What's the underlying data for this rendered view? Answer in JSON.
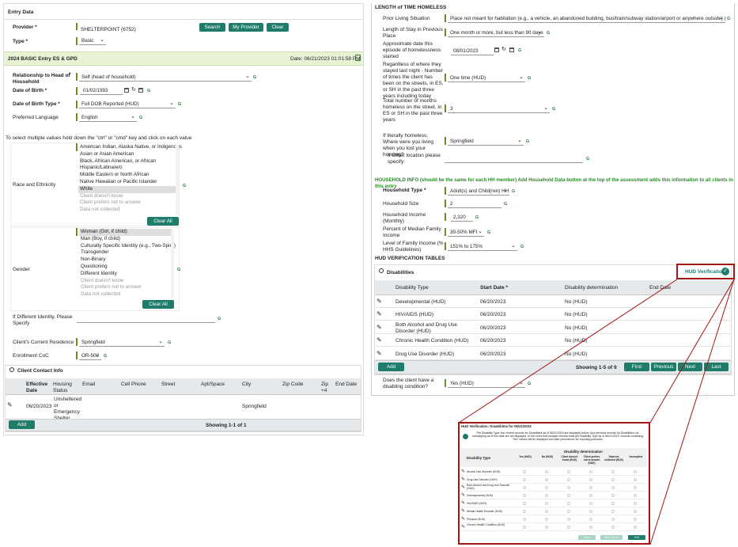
{
  "left": {
    "section_title": "Entry Data",
    "provider_label": "Provider *",
    "provider_value": "SHELTERPOINT (6752)",
    "search_btn": "Search",
    "my_provider_btn": "My Provider",
    "clear_btn": "Clear",
    "type_label": "Type *",
    "type_value": "Basic",
    "entry_header": "2024 BASIC Entry ES & GPD",
    "entry_date": "Date: 06/21/2023 01:01:58 PM",
    "rel_label": "Relationship to Head of Household",
    "rel_value": "Self (head of household)",
    "dob_label": "Date of Birth *",
    "dob_value": "01/02/1993",
    "dobtype_label": "Date of Birth Type *",
    "dobtype_value": "Full DOB Reported (HUD)",
    "lang_label": "Preferred Language",
    "lang_value": "English",
    "multi_hint": "To select multiple values hold down the \"ctrl\" or \"cmd\" key and click on each value",
    "race_label": "Race and Ethnicity",
    "race_options": [
      "American Indian, Alaska Native, or Indigenous",
      "Asian or Asian American",
      "Black, African American, or African",
      "Hispanic/Latina/e/o",
      "Middle Eastern or North African",
      "Native Hawaiian or Pacific Islander",
      "White",
      "Client doesn't know",
      "Client prefers not to answer",
      "Data not collected"
    ],
    "clear_all": "Clear All",
    "gender_label": "Gender",
    "gender_options": [
      "Woman (Girl, if child)",
      "Man (Boy, if child)",
      "Culturally Specific Identity (e.g., Two-Spirit)",
      "Transgender",
      "Non-Binary",
      "Questioning",
      "Different Identity",
      "Client doesn't know",
      "Client prefers not to answer",
      "Data not collected"
    ],
    "diff_identity_label": "If Different Identity, Please Specify",
    "residence_label": "Client's Current Residence",
    "residence_value": "Springfield",
    "coc_label": "Enrollment CoC",
    "coc_value": "OR-500",
    "g": "G",
    "contact_title": "Client Contact Info",
    "contact_cols": [
      "Effective Date",
      "Housing Status",
      "Email",
      "Cell Phone",
      "Street",
      "Apt/Space",
      "City",
      "Zip Code",
      "Zip +4",
      "End Date"
    ],
    "contact_row": {
      "date": "06/20/2023",
      "status": "Unsheltered or Emergency Shelter",
      "city": "Springfield"
    },
    "add_btn": "Add",
    "showing": "Showing 1-1 of 1"
  },
  "right": {
    "homeless_title": "LENGTH of TIME HOMELESS",
    "prior_label": "Prior Living Situation",
    "prior_value": "Place not meant for habitation (e.g., a vehicle, an abandoned building, bus/train/subway station/airport or anywhere outside) (HUD)",
    "los_label": "Length of Stay in Previous Place",
    "los_value": "One month or more, but less than 90 days",
    "approx_label": "Approximate date this episode of homelessness started",
    "approx_value": "08/01/2023",
    "times_label": "Regardless of where they stayed last night - Number of times the client has been on the streets, in ES, or SH in the past three years including today",
    "times_value": "One time (HUD)",
    "months_label": "Total number of months homeless on the street, in ES or SH in the past three years",
    "months_value": "3",
    "where_label": "If literally homeless, Where were you living when you lost your housing?",
    "where_value": "Springfield",
    "other_label": "If Other location please specify:",
    "hh_info": "HOUSEHOLD INFO (should be the same for each HH member) Add Household Data button at the top of the assessment adds this information to all clients in this entry",
    "hhtype_label": "Household Type *",
    "hhtype_value": "Adult(s) and Child(ren) HH",
    "hhsize_label": "Household Size",
    "hhsize_value": "2",
    "income_label": "Household Income (Monthly)",
    "income_value": "2,320",
    "pct_label": "Percent of Median Family Income",
    "pct_value": "30-50% MFI",
    "fpl_label": "Level of Family Income (% HHS Guidelines)",
    "fpl_value": "151% to 175%",
    "hud_tables": "HUD VERIFICATION TABLES",
    "dis_title": "Disabilities",
    "hud_verif": "HUD Verification",
    "dis_cols": [
      "Disability Type",
      "Start Date *",
      "Disability determination",
      "End Date"
    ],
    "dis_rows": [
      {
        "type": "Developmental (HUD)",
        "date": "06/20/2023",
        "det": "No (HUD)"
      },
      {
        "type": "HIV/AIDS (HUD)",
        "date": "06/20/2023",
        "det": "No (HUD)"
      },
      {
        "type": "Both Alcohol and Drug Use Disorder (HUD)",
        "date": "06/20/2023",
        "det": "No (HUD)"
      },
      {
        "type": "Chronic Health Condition (HUD)",
        "date": "06/20/2023",
        "det": "No (HUD)"
      },
      {
        "type": "Drug Use Disorder (HUD)",
        "date": "06/20/2023",
        "det": "No (HUD)"
      }
    ],
    "add_btn": "Add",
    "showing": "Showing 1-5 of 9",
    "first": "First",
    "previous": "Previous",
    "next": "Next",
    "last": "Last",
    "disabling_label": "Does the client have a disabling condition?",
    "disabling_value": "Yes (HUD)"
  },
  "popup": {
    "title": "HUD Verification: Disabilities for 06/21/2023",
    "info": "Per Disability Type, the current records for Disabilities as of 06/21/2023 are displayed below. Any previous records for Disabilities not overlapping as of this date are not displayed. In the event that multiple records exist per Disability Type as of 06/21/2023, records containing \"Yes\" values will be displayed and take precedence for reporting purposes.",
    "det_header": "Disability determination",
    "type_header": "Disability Type",
    "cols": [
      "Yes (HUD)",
      "No (HUD)",
      "Client doesn't know (HUD)",
      "Client prefers not to answer (HUD)",
      "Data not collected (HUD)",
      "Incomplete"
    ],
    "rows": [
      "Alcohol Use Disorder (HUD)",
      "Drug Use Disorder (HUD)",
      "Both Alcohol and Drug Use Disorder (HUD)",
      "Developmental (HUD)",
      "HIV/AIDS (HUD)",
      "Mental Health Disorder (HUD)",
      "Physical (HUD)",
      "Chronic Health Condition (HUD)"
    ],
    "btn1": "Save",
    "btn2": "Save & Exit",
    "btn3": "Exit"
  },
  "colors": {
    "accent": "#1f7c6a",
    "highlight": "#a31515",
    "entry_bg": "#e8f3d6"
  }
}
